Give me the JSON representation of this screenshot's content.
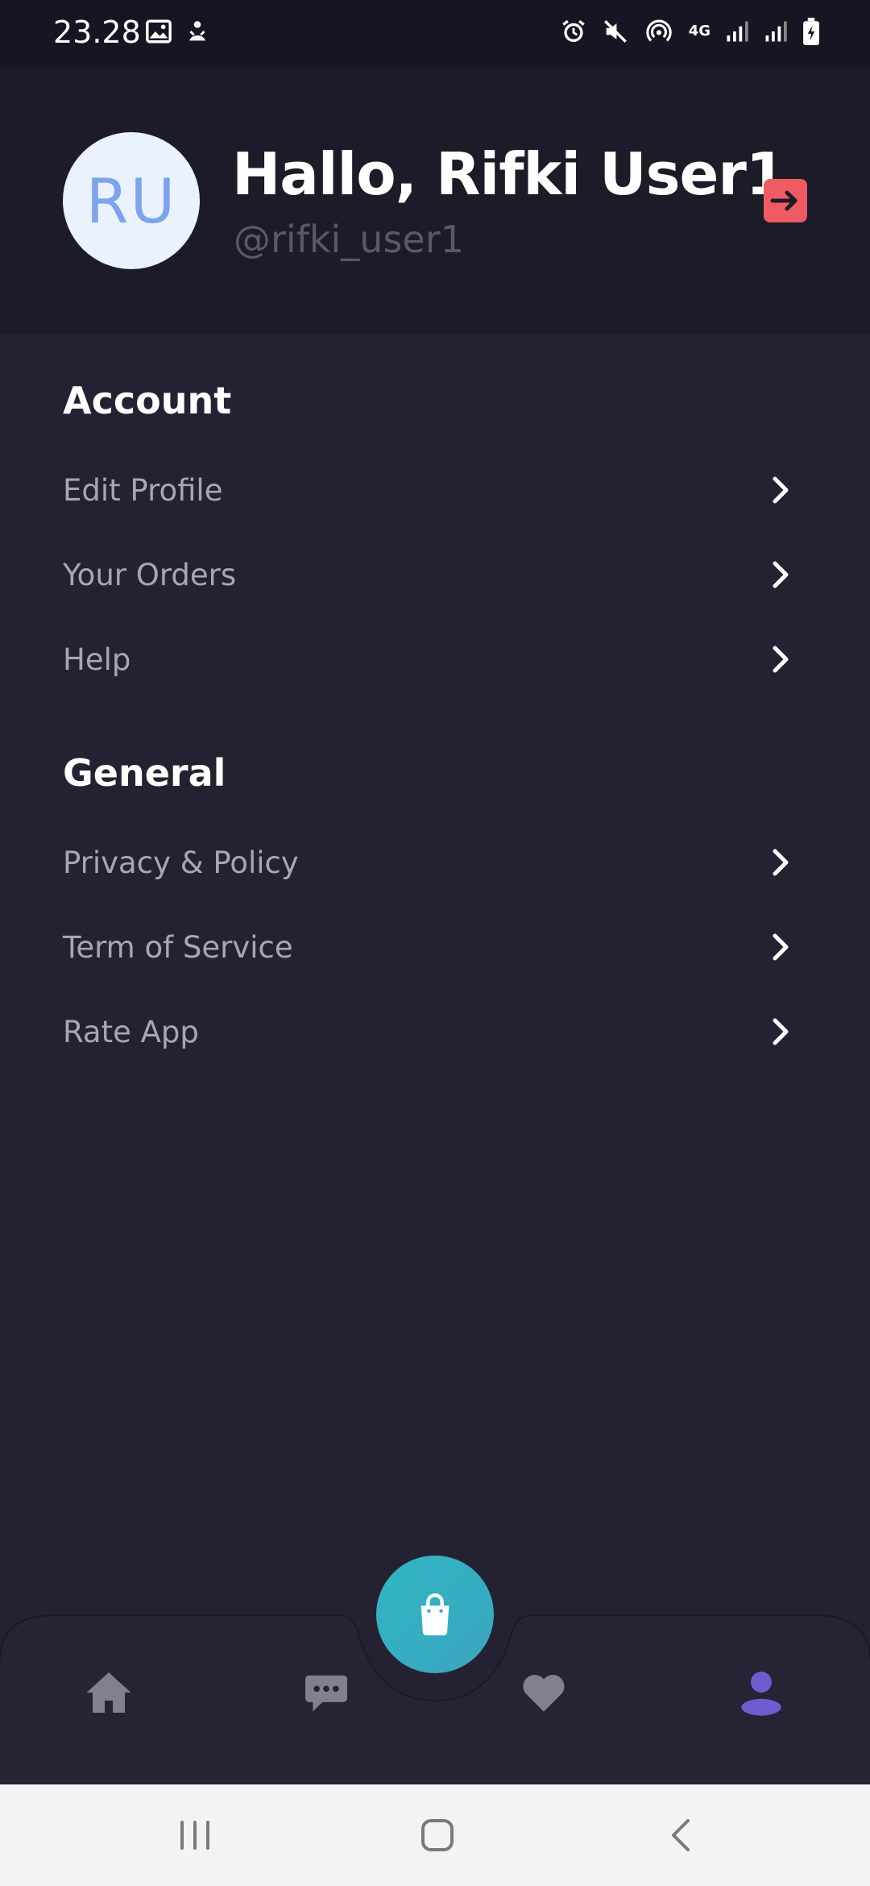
{
  "status_bar": {
    "time": "23.28",
    "network": "4G"
  },
  "profile": {
    "initials": "RU",
    "greeting": "Hallo, Rifki User1",
    "username": "@rifki_user1"
  },
  "sections": {
    "account": {
      "title": "Account",
      "items": [
        "Edit Profile",
        "Your Orders",
        "Help"
      ]
    },
    "general": {
      "title": "General",
      "items": [
        "Privacy & Policy",
        "Term of Service",
        "Rate App"
      ]
    }
  },
  "bottom_nav": {
    "items": [
      "home-icon",
      "chat-icon",
      "heart-icon",
      "profile-icon"
    ],
    "active": "profile-icon",
    "fab_icon": "shopping-bag-icon"
  },
  "colors": {
    "background": "#242232",
    "header": "#1c1b28",
    "accent": "#6c5ccf",
    "fab": "#33adc1",
    "logout": "#ef5b62"
  }
}
